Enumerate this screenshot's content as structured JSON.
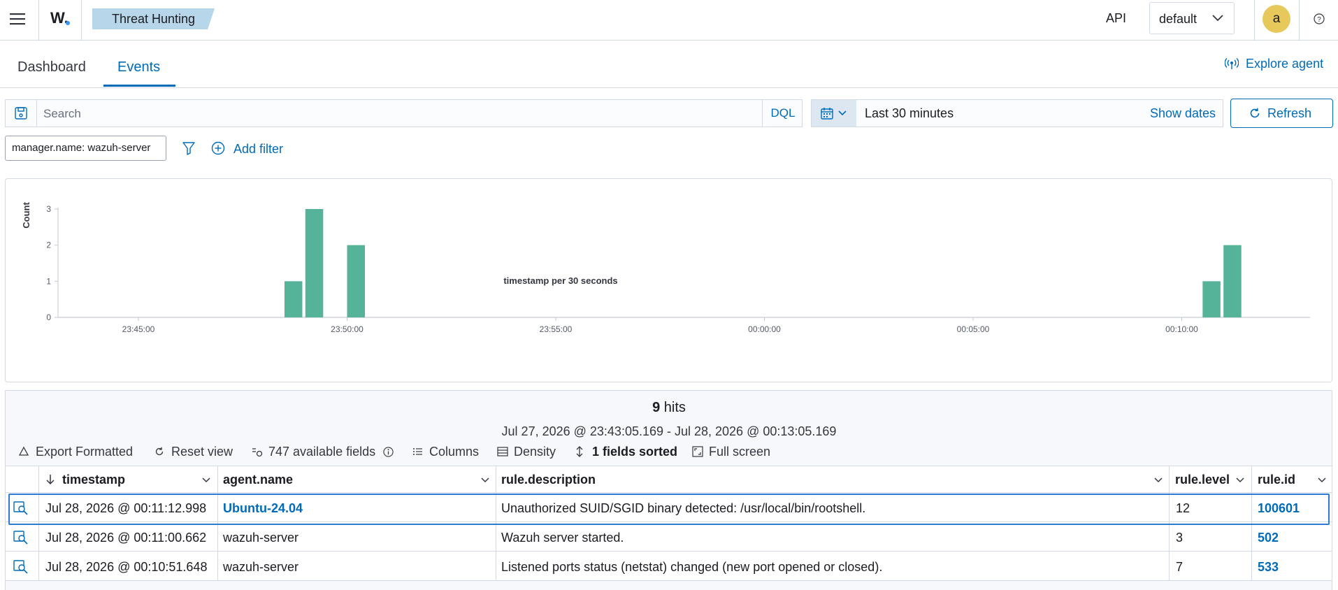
{
  "header": {
    "app_logo": "W.",
    "breadcrumb": "Threat Hunting",
    "api_label": "API",
    "server_select": "default",
    "user_initial": "a",
    "icons": [
      "menu-icon",
      "help-icon",
      "chevron-down-icon"
    ]
  },
  "tabs": [
    {
      "label": "Dashboard",
      "active": false
    },
    {
      "label": "Events",
      "active": true
    }
  ],
  "explore_agent": "Explore agent",
  "search": {
    "placeholder": "Search",
    "value": "",
    "language": "DQL"
  },
  "date_picker": {
    "range": "Last 30 minutes",
    "show_dates": "Show dates",
    "refresh": "Refresh"
  },
  "filters": {
    "active": [
      "manager.name: wazuh-server"
    ],
    "add_label": "Add filter"
  },
  "chart_data": {
    "type": "bar",
    "title": "",
    "xlabel": "timestamp per 30 seconds",
    "ylabel": "Count",
    "ylim": [
      0,
      3
    ],
    "yticks": [
      "0",
      "1",
      "2",
      "3"
    ],
    "xticks": [
      "23:45:00",
      "23:50:00",
      "23:55:00",
      "00:00:00",
      "00:05:00",
      "00:10:00"
    ],
    "x": [
      "23:48:30",
      "23:49:00",
      "23:50:00",
      "00:10:30",
      "00:11:00"
    ],
    "values": [
      1,
      3,
      2,
      1,
      2
    ],
    "color": "#54b399",
    "grid": false
  },
  "results": {
    "hits_count": "9",
    "hits_label": "hits",
    "time_range": "Jul 27, 2026 @ 23:43:05.169 - Jul 28, 2026 @ 00:13:05.169",
    "toolbar": {
      "export": "Export Formatted",
      "reset": "Reset view",
      "fields": "747 available fields",
      "columns": "Columns",
      "density": "Density",
      "sorted": "1 fields sorted",
      "fullscreen": "Full screen"
    },
    "columns": [
      "timestamp",
      "agent.name",
      "rule.description",
      "rule.level",
      "rule.id"
    ],
    "rows": [
      {
        "timestamp": "Jul 28, 2026 @ 00:11:12.998",
        "agent": "Ubuntu-24.04",
        "description": "Unauthorized SUID/SGID binary detected: /usr/local/bin/rootshell.",
        "level": "12",
        "id": "100601"
      },
      {
        "timestamp": "Jul 28, 2026 @ 00:11:00.662",
        "agent": "wazuh-server",
        "description": "Wazuh server started.",
        "level": "3",
        "id": "502"
      },
      {
        "timestamp": "Jul 28, 2026 @ 00:10:51.648",
        "agent": "wazuh-server",
        "description": "Listened ports status (netstat) changed (new port opened or closed).",
        "level": "7",
        "id": "533"
      }
    ]
  },
  "colors": {
    "accent": "#006bb8",
    "bar": "#54b399",
    "breadcrumb_bg": "#b8d6ea",
    "avatar_bg": "#e7c85a"
  }
}
